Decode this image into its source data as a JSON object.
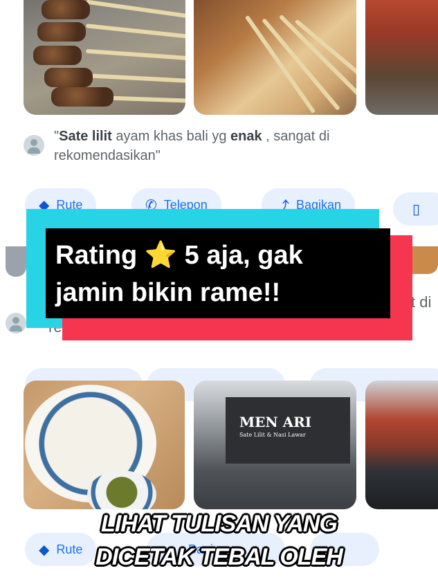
{
  "review": {
    "quote_open": "\"",
    "bold1": "Sate lilit",
    "text1": " ayam khas bali yg ",
    "bold2": "enak",
    "text2": " , sangat di rekomendasikan\""
  },
  "actions": {
    "route": "Rute",
    "phone": "Telepon",
    "share": "Bagikan"
  },
  "overlay": {
    "headline_line1": "Rating ⭐ 5 aja, gak",
    "headline_line2": "jamin bikin rame!!"
  },
  "peek": {
    "left_text": "re",
    "right_text": "t di"
  },
  "restaurant_sign": {
    "name": "MEN ARI",
    "tagline": "Sate Lilit & Nasi Lawar"
  },
  "bottom_actions": {
    "route": "Rute",
    "share": "Bagi"
  },
  "caption": {
    "line1": "LIHAT TULISAN YANG",
    "line2": "DICETAK TEBAL OLEH"
  },
  "icons": {
    "route": "directions-icon",
    "phone": "phone-icon",
    "share": "share-icon",
    "save": "bookmark-icon"
  }
}
